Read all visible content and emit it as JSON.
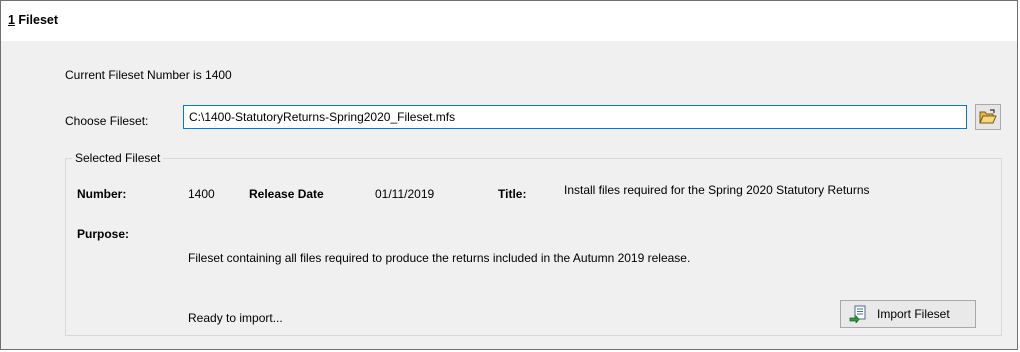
{
  "section": {
    "number": "1",
    "title": " Fileset"
  },
  "current_fileset_text": "Current Fileset Number is 1400",
  "choose": {
    "label": "Choose Fileset:",
    "value": "C:\\1400-StatutoryReturns-Spring2020_Fileset.mfs",
    "browse_icon": "open-folder-icon"
  },
  "selected": {
    "legend": "Selected Fileset",
    "number_label": "Number:",
    "number_value": "1400",
    "release_label": "Release Date",
    "release_value": "01/11/2019",
    "title_label": "Title:",
    "title_value": "Install files required for the Spring 2020 Statutory Returns",
    "purpose_label": "Purpose:",
    "purpose_value": "Fileset containing all files required to produce the returns included in the Autumn 2019 release.",
    "status": "Ready to import...",
    "import_button": "Import Fileset",
    "import_icon": "import-icon"
  }
}
